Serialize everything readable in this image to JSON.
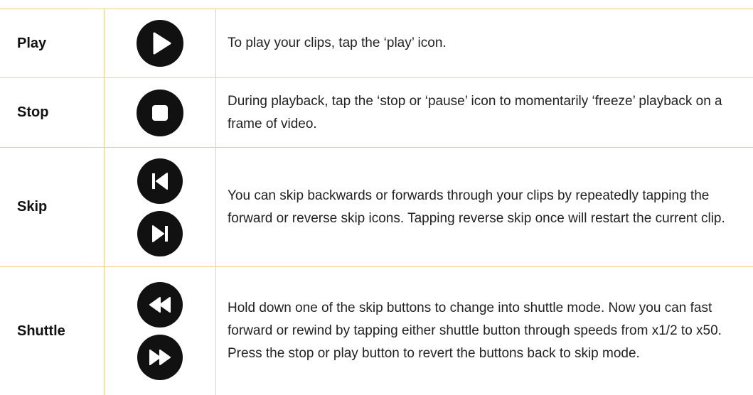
{
  "rows": [
    {
      "name": "Play",
      "icons": [
        "play-icon"
      ],
      "description": "To play your clips, tap the ‘play’ icon."
    },
    {
      "name": "Stop",
      "icons": [
        "stop-icon"
      ],
      "description": "During playback, tap the ‘stop or ‘pause’ icon to momentarily ‘freeze’ playback on a frame of video."
    },
    {
      "name": "Skip",
      "icons": [
        "skip-back-icon",
        "skip-forward-icon"
      ],
      "description": "You can skip backwards or forwards through your clips by repeatedly tapping the forward or reverse skip icons. Tapping reverse skip once will restart the current clip."
    },
    {
      "name": "Shuttle",
      "icons": [
        "rewind-icon",
        "fast-forward-icon"
      ],
      "description": "Hold down one of the skip buttons to change into shuttle mode. Now you can fast forward or rewind by tapping either shuttle button through speeds from x1/2 to x50. Press the stop or play button to revert the buttons back to skip mode."
    }
  ],
  "colors": {
    "border": "#f3cf83",
    "icon_fill": "#111111",
    "icon_glyph": "#ffffff"
  }
}
